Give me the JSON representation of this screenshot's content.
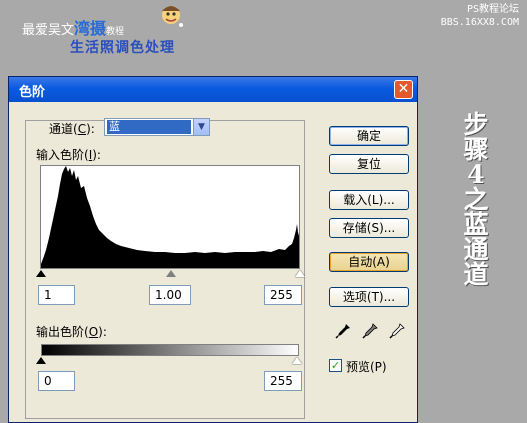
{
  "banner": {
    "left_text_1": "最爱吴文",
    "left_highlight": "湾摄",
    "left_small": "教程",
    "subtitle": "生活照调色处理",
    "site_line1": "PS教程论坛",
    "site_line2": "BBS.16XX8.COM"
  },
  "side_text": [
    "步",
    "骤",
    "4",
    "之",
    "蓝",
    "通",
    "道"
  ],
  "dialog": {
    "title": "色阶",
    "close_symbol": "✕",
    "channel_label": "通道(",
    "channel_key": "C",
    "channel_label_end": "):",
    "channel_value": "蓝",
    "input_levels_label": "输入色阶(",
    "input_levels_key": "I",
    "input_levels_end": "):",
    "input_values": {
      "black": "1",
      "gamma": "1.00",
      "white": "255"
    },
    "output_levels_label": "输出色阶(",
    "output_levels_key": "O",
    "output_levels_end": "):",
    "output_values": {
      "black": "0",
      "white": "255"
    }
  },
  "buttons": {
    "ok": "确定",
    "reset": "复位",
    "load": "载入(L)...",
    "save": "存储(S)...",
    "auto": "自动(A)",
    "options": "选项(T)..."
  },
  "preview": {
    "label": "预览(P)",
    "checked": true,
    "check_symbol": "✓"
  },
  "icons": [
    "black-eyedropper-icon",
    "gray-eyedropper-icon",
    "white-eyedropper-icon"
  ]
}
